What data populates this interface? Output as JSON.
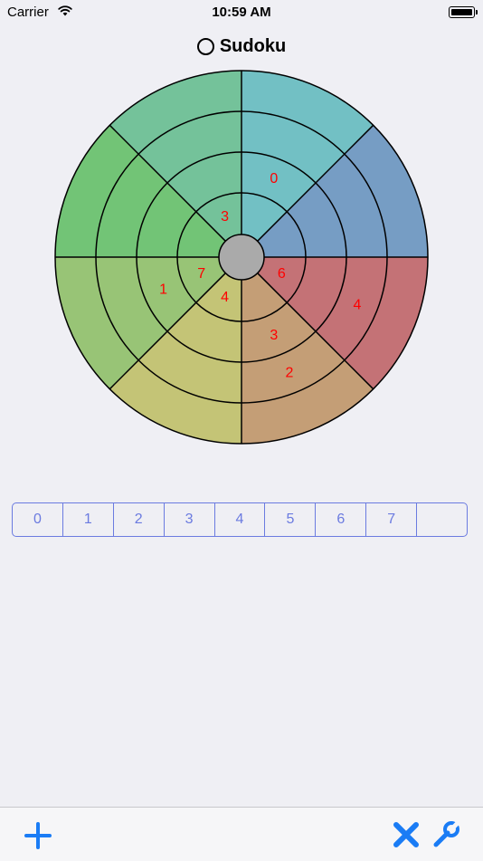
{
  "status_bar": {
    "carrier": "Carrier",
    "time": "10:59 AM"
  },
  "nav": {
    "title": "Sudoku"
  },
  "board": {
    "wedge_colors": [
      "#72c0c4",
      "#769dc4",
      "#c47276",
      "#c49e76",
      "#c4c476",
      "#98c476",
      "#72c476",
      "#74c29a"
    ],
    "hub_color": "#aaaaaa",
    "cells": [
      {
        "wedge": 0,
        "ring": 2,
        "value": "0"
      },
      {
        "wedge": 2,
        "ring": 1,
        "value": "6"
      },
      {
        "wedge": 2,
        "ring": 3,
        "value": "4"
      },
      {
        "wedge": 3,
        "ring": 2,
        "value": "3"
      },
      {
        "wedge": 3,
        "ring": 3,
        "value": "2"
      },
      {
        "wedge": 4,
        "ring": 1,
        "value": "4"
      },
      {
        "wedge": 5,
        "ring": 1,
        "value": "7"
      },
      {
        "wedge": 5,
        "ring": 2,
        "value": "1"
      },
      {
        "wedge": 7,
        "ring": 1,
        "value": "3"
      }
    ]
  },
  "picker": {
    "options": [
      "0",
      "1",
      "2",
      "3",
      "4",
      "5",
      "6",
      "7",
      ""
    ]
  },
  "toolbar": {
    "add": "add",
    "clear": "clear",
    "settings": "settings"
  }
}
